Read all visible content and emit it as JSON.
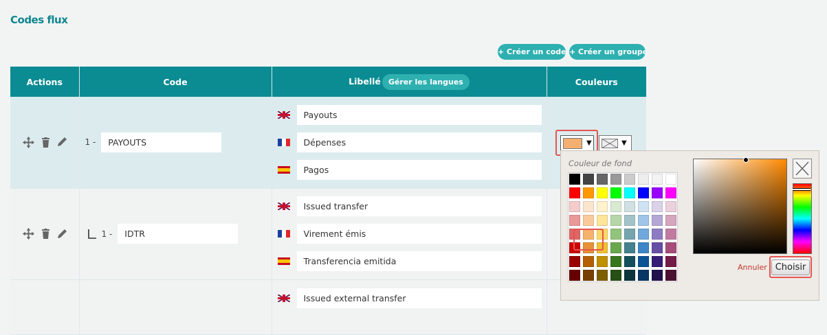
{
  "page": {
    "title": "Codes flux"
  },
  "toolbar": {
    "create_code": "+ Créer un code",
    "create_group": "+ Créer un groupe"
  },
  "table": {
    "headers": {
      "actions": "Actions",
      "code": "Code",
      "libelle": "Libellé",
      "couleurs": "Couleurs"
    },
    "manage_languages": "Gérer les langues",
    "rows": [
      {
        "prefix": "1 -",
        "code": "PAYOUTS",
        "labels": {
          "en": "Payouts",
          "fr": "Dépenses",
          "es": "Pagos"
        }
      },
      {
        "prefix": "1 -",
        "code": "IDTR",
        "labels": {
          "en": "Issued transfer",
          "fr": "Virement émis",
          "es": "Transferencia emitida"
        }
      },
      {
        "labels": {
          "en": "Issued external transfer"
        }
      }
    ]
  },
  "colors": {
    "accent": "#0b8c93",
    "selected_swatch": "#f4b070",
    "picker": {
      "label": "Couleur de fond",
      "cancel": "Annuler",
      "choose": "Choisir",
      "palette": [
        "#000000",
        "#444444",
        "#666666",
        "#999999",
        "#cccccc",
        "#eeeeee",
        "#f3f3f3",
        "#ffffff",
        "#ff0000",
        "#ff9900",
        "#ffff00",
        "#00ff00",
        "#00ffff",
        "#0000ff",
        "#9900ff",
        "#ff00ff",
        "#f4cccc",
        "#fce5cd",
        "#fff2cc",
        "#d9ead3",
        "#d0e0e3",
        "#cfe2f3",
        "#d9d2e9",
        "#ead1dc",
        "#ea9999",
        "#f9cb9c",
        "#ffe599",
        "#b6d7a8",
        "#a2c4c9",
        "#9fc5e8",
        "#b4a7d6",
        "#d5a6bd",
        "#e06666",
        "#f6b26b",
        "#ffd966",
        "#93c47d",
        "#76a5af",
        "#6fa8dc",
        "#8e7cc3",
        "#c27ba0",
        "#cc0000",
        "#e69138",
        "#f1c232",
        "#6aa84f",
        "#45818e",
        "#3d85c6",
        "#674ea7",
        "#a64d79",
        "#990000",
        "#b45f06",
        "#bf9000",
        "#38761d",
        "#134f5c",
        "#0b5394",
        "#351c75",
        "#741b47",
        "#660000",
        "#783f04",
        "#7f6000",
        "#274e13",
        "#0c343d",
        "#073763",
        "#20124d",
        "#4c1130"
      ]
    }
  }
}
